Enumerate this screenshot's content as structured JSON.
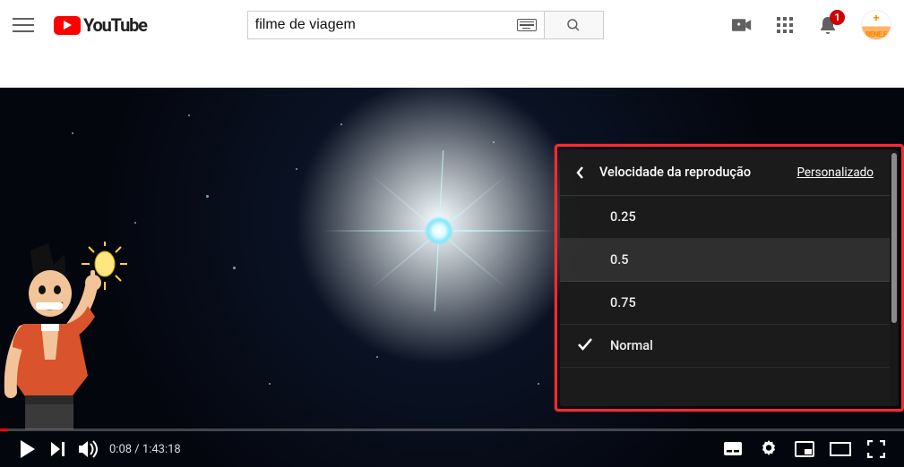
{
  "header": {
    "logo_text": "YouTube",
    "search_value": "filme de viagem",
    "notifications_count": "1",
    "avatar_text": "RENE.F"
  },
  "player": {
    "time_current": "0:08",
    "time_separator": " / ",
    "time_total": "1:43:18"
  },
  "settings_panel": {
    "title": "Velocidade da reprodução",
    "custom_label": "Personalizado",
    "options": [
      {
        "label": "0.25",
        "selected": false
      },
      {
        "label": "0.5",
        "selected": false,
        "hover": true
      },
      {
        "label": "0.75",
        "selected": false
      },
      {
        "label": "Normal",
        "selected": true
      }
    ]
  }
}
